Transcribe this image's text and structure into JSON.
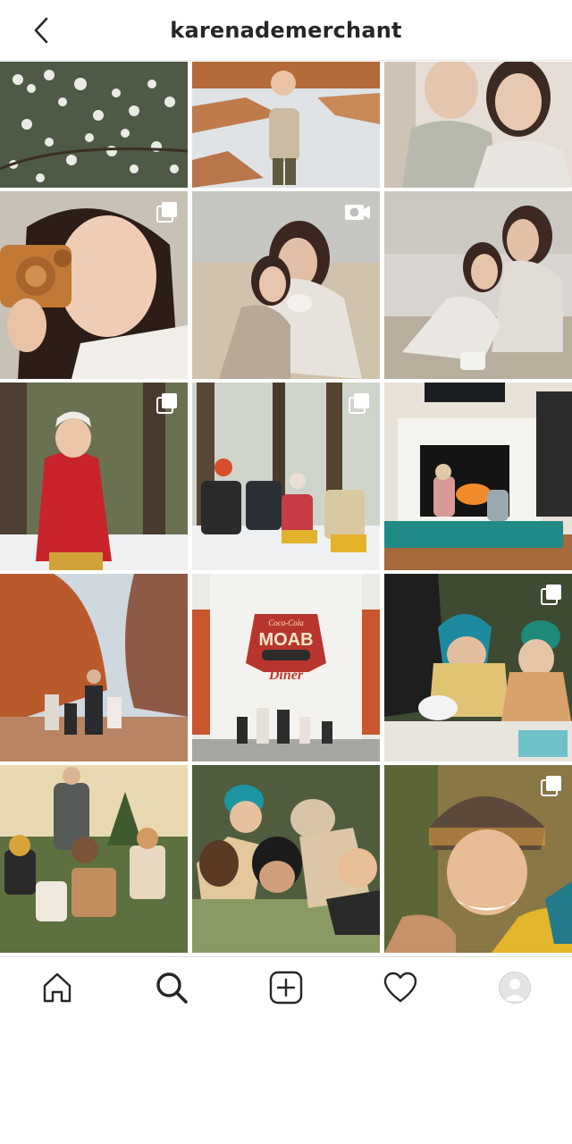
{
  "header": {
    "title": "karenademerchant",
    "back_icon": "chevron-left-icon"
  },
  "grid": {
    "tiles": [
      {
        "alt": "white blossoms",
        "badge": ""
      },
      {
        "alt": "boy on snowy rocks",
        "badge": ""
      },
      {
        "alt": "two kids portrait",
        "badge": ""
      },
      {
        "alt": "girl with wooden camera",
        "badge": "carousel-icon"
      },
      {
        "alt": "mother and daughter on sofa",
        "badge": "video-icon"
      },
      {
        "alt": "mother and daughter on floor",
        "badge": ""
      },
      {
        "alt": "girl in red coat in snow",
        "badge": "carousel-icon"
      },
      {
        "alt": "kids sitting in snowy forest",
        "badge": "carousel-icon"
      },
      {
        "alt": "kids by fireplace",
        "badge": ""
      },
      {
        "alt": "family among red rocks",
        "badge": ""
      },
      {
        "alt": "family at diner",
        "badge": ""
      },
      {
        "alt": "kids doing crafts",
        "badge": "carousel-icon"
      },
      {
        "alt": "family at tree farm",
        "badge": ""
      },
      {
        "alt": "kids lying in grass",
        "badge": ""
      },
      {
        "alt": "smiling girl in beanie",
        "badge": "carousel-icon"
      }
    ],
    "diner_sign": {
      "top": "Coca-Cola",
      "mid": "MOAB",
      "bot": "Diner"
    }
  },
  "tabbar": {
    "items": [
      "home-icon",
      "search-icon",
      "new-post-icon",
      "activity-heart-icon",
      "profile-avatar-icon"
    ]
  },
  "colors": {
    "text": "#262626",
    "border": "#dbdbdb"
  }
}
